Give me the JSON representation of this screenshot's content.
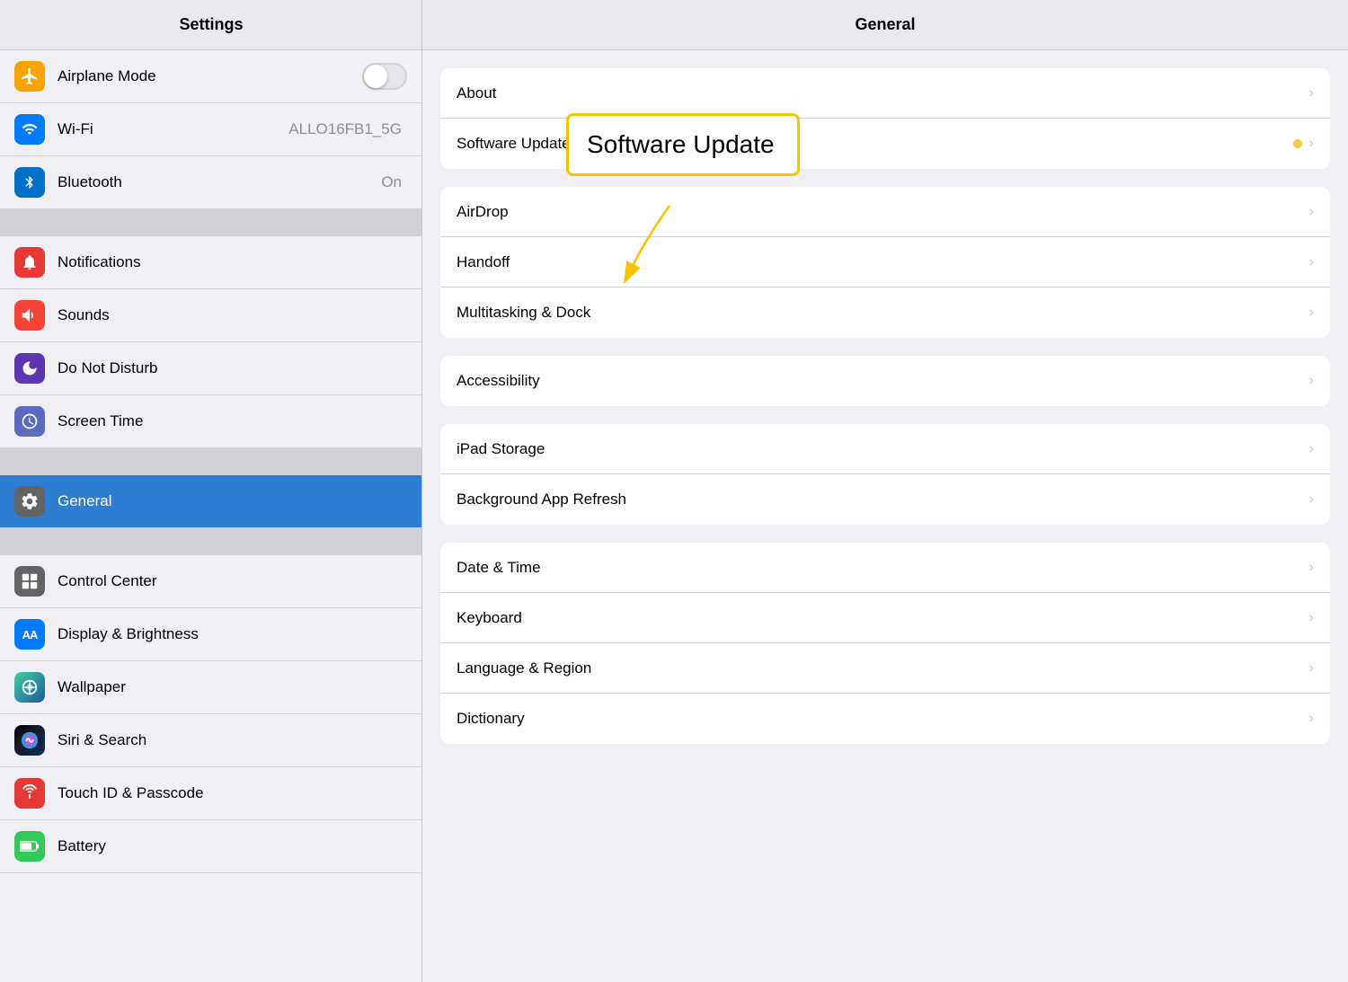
{
  "sidebar": {
    "title": "Settings",
    "items": [
      {
        "id": "airplane-mode",
        "label": "Airplane Mode",
        "icon": "✈",
        "iconClass": "icon-orange",
        "hasToggle": true,
        "value": ""
      },
      {
        "id": "wifi",
        "label": "Wi-Fi",
        "icon": "📶",
        "iconClass": "icon-blue",
        "value": "ALLO16FB1_5G"
      },
      {
        "id": "bluetooth",
        "label": "Bluetooth",
        "icon": "B",
        "iconClass": "icon-blue2",
        "value": "On"
      },
      {
        "id": "notifications",
        "label": "Notifications",
        "icon": "🔔",
        "iconClass": "icon-red",
        "value": ""
      },
      {
        "id": "sounds",
        "label": "Sounds",
        "icon": "🔊",
        "iconClass": "icon-red2",
        "value": ""
      },
      {
        "id": "do-not-disturb",
        "label": "Do Not Disturb",
        "icon": "🌙",
        "iconClass": "icon-purple",
        "value": ""
      },
      {
        "id": "screen-time",
        "label": "Screen Time",
        "icon": "⏳",
        "iconClass": "icon-indigo",
        "value": ""
      },
      {
        "id": "general",
        "label": "General",
        "icon": "⚙",
        "iconClass": "icon-gray2",
        "active": true,
        "value": ""
      },
      {
        "id": "control-center",
        "label": "Control Center",
        "icon": "☰",
        "iconClass": "icon-gray2",
        "value": ""
      },
      {
        "id": "display",
        "label": "Display & Brightness",
        "icon": "AA",
        "iconClass": "icon-blue",
        "value": ""
      },
      {
        "id": "wallpaper",
        "label": "Wallpaper",
        "icon": "✿",
        "iconClass": "icon-gradient-wallpaper",
        "value": ""
      },
      {
        "id": "siri",
        "label": "Siri & Search",
        "icon": "◉",
        "iconClass": "icon-gradient-siri",
        "value": ""
      },
      {
        "id": "touch-id",
        "label": "Touch ID & Passcode",
        "icon": "◎",
        "iconClass": "icon-fingerprint",
        "value": ""
      },
      {
        "id": "battery",
        "label": "Battery",
        "icon": "🔋",
        "iconClass": "icon-green",
        "value": ""
      }
    ]
  },
  "rightPanel": {
    "title": "General",
    "groups": [
      {
        "id": "group1",
        "rows": [
          {
            "id": "about",
            "label": "About",
            "hasChevron": true
          },
          {
            "id": "software-update",
            "label": "Software Update",
            "hasChevron": true,
            "hasDot": true
          }
        ]
      },
      {
        "id": "group2",
        "rows": [
          {
            "id": "airdrop",
            "label": "AirDrop",
            "hasChevron": true
          },
          {
            "id": "handoff",
            "label": "Handoff",
            "hasChevron": true
          },
          {
            "id": "multitasking",
            "label": "Multitasking & Dock",
            "hasChevron": true
          }
        ]
      },
      {
        "id": "group3",
        "rows": [
          {
            "id": "accessibility",
            "label": "Accessibility",
            "hasChevron": true
          }
        ]
      },
      {
        "id": "group4",
        "rows": [
          {
            "id": "ipad-storage",
            "label": "iPad Storage",
            "hasChevron": true
          },
          {
            "id": "background-refresh",
            "label": "Background App Refresh",
            "hasChevron": true
          }
        ]
      },
      {
        "id": "group5",
        "rows": [
          {
            "id": "date-time",
            "label": "Date & Time",
            "hasChevron": true
          },
          {
            "id": "keyboard",
            "label": "Keyboard",
            "hasChevron": true
          },
          {
            "id": "language-region",
            "label": "Language & Region",
            "hasChevron": true
          },
          {
            "id": "dictionary",
            "label": "Dictionary",
            "hasChevron": true
          }
        ]
      }
    ],
    "callout": {
      "title": "Software Update"
    }
  },
  "icons": {
    "chevron": "›"
  }
}
